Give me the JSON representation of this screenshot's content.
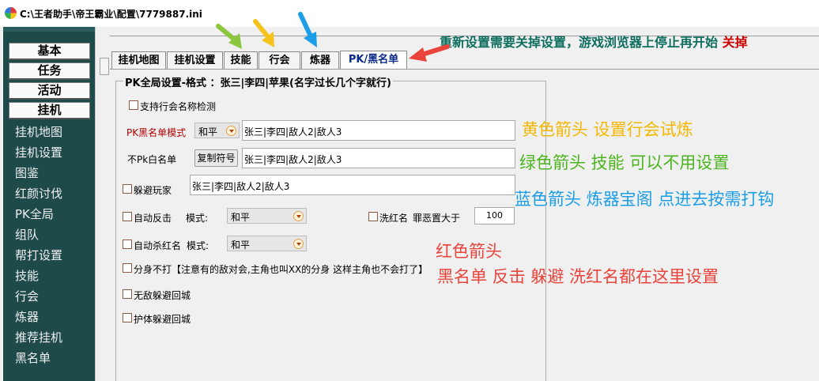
{
  "window": {
    "title": "C:\\王者助手\\帝王霸业\\配置\\7779887.ini"
  },
  "sidebar": {
    "buttons": [
      "基本",
      "任务",
      "活动",
      "挂机"
    ],
    "links": [
      "挂机地图",
      "挂机设置",
      "图鉴",
      "红颜讨伐",
      "PK全局",
      "组队",
      "帮打设置",
      "技能",
      "行会",
      "炼器",
      "推荐挂机",
      "黑名单"
    ]
  },
  "tabs": [
    "挂机地图",
    "挂机设置",
    "技能",
    "行会",
    "炼器",
    "PK/黑名单"
  ],
  "notice": {
    "text": "重新设置需要关掉设置，游戏浏览器上停止再开始",
    "tail": "关掉"
  },
  "group": {
    "title": "PK全局设置-格式 ：张三|李四|苹果(名字过长几个字就行)",
    "support_guild_check": "支持行会名称检测",
    "blacklist_mode_label": "PK黑名单模式",
    "blacklist_mode_value": "和平",
    "blacklist_text": "张三|李四|敌人2|敌人3",
    "whitelist_label": "不Pk白名单",
    "copy_symbol_button": "复制符号",
    "whitelist_text": "张三|李四|敌人2|敌人3",
    "avoid_player_label": "躲避玩家",
    "avoid_player_text": "张三|李四|敌人2|敌人3",
    "auto_counter_label": "自动反击",
    "mode_label": "模式:",
    "auto_counter_mode": "和平",
    "wash_red_label": "洗红名",
    "sin_value_label": "罪恶置大于",
    "sin_value": "100",
    "auto_kill_red_label": "自动杀红名",
    "mode_label2": "模式:",
    "auto_kill_mode": "和平",
    "clone_note": "分身不打【注意有的敌对会,主角也叫XX的分身 这样主角也不会打了】",
    "invincible_avoid": "无敌躲避回城",
    "shield_avoid": "护体躲避回城"
  },
  "annotations": {
    "yellow": "黄色箭头 设置行会试炼",
    "green": "绿色箭头  技能   可以不用设置",
    "blue": "蓝色箭头 炼器宝阁 点进去按需打钩",
    "red1": "红色箭头",
    "red2": "黑名单 反击 躲避 洗红名都在这里设置"
  },
  "colors": {
    "yellow": "#f2b800",
    "green": "#8cc63f",
    "blue": "#1c9ee6",
    "red": "#e8443c",
    "sidebar_bg": "#1e4a4a"
  }
}
